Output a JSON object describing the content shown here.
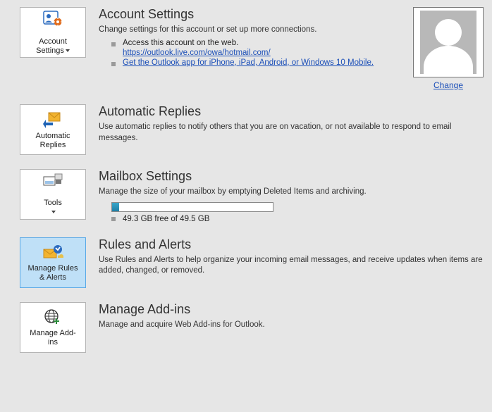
{
  "accountSettings": {
    "tile": "Account\nSettings",
    "heading": "Account Settings",
    "desc": "Change settings for this account or set up more connections.",
    "bullet1": "Access this account on the web.",
    "linkUrl": "https://outlook.live.com/owa/hotmail.com/",
    "bullet2": "Get the Outlook app for iPhone, iPad, Android, or Windows 10 Mobile.",
    "changeLabel": "Change"
  },
  "automaticReplies": {
    "tile": "Automatic\nReplies",
    "heading": "Automatic Replies",
    "desc": "Use automatic replies to notify others that you are on vacation, or not available to respond to email messages."
  },
  "mailboxSettings": {
    "tile": "Tools",
    "heading": "Mailbox Settings",
    "desc": "Manage the size of your mailbox by emptying Deleted Items and archiving.",
    "storageText": "49.3 GB free of 49.5 GB"
  },
  "rulesAlerts": {
    "tile": "Manage Rules\n& Alerts",
    "heading": "Rules and Alerts",
    "desc": "Use Rules and Alerts to help organize your incoming email messages, and receive updates when items are added, changed, or removed."
  },
  "addIns": {
    "tile": "Manage Add-\nins",
    "heading": "Manage Add-ins",
    "desc": "Manage and acquire Web Add-ins for Outlook."
  }
}
